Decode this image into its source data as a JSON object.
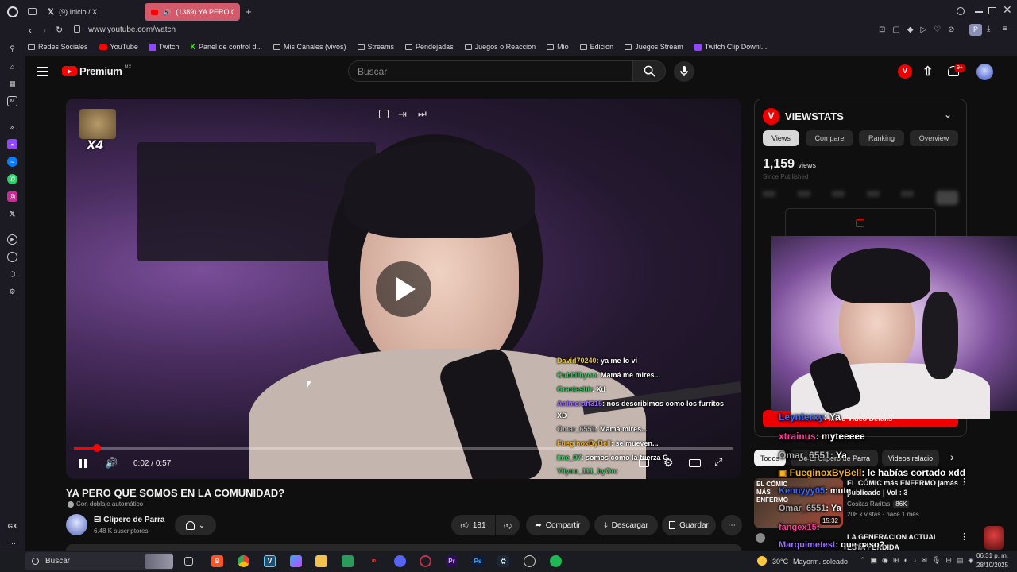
{
  "browser": {
    "tabs": [
      {
        "label": "(9) Inicio / X"
      },
      {
        "label": "(1389) YA PERO QUE"
      }
    ],
    "new_tab": "+",
    "url": "www.youtube.com/watch",
    "bookmarks": [
      {
        "label": "Redes Sociales"
      },
      {
        "label": "YouTube"
      },
      {
        "label": "Twitch"
      },
      {
        "label": "Panel de control d..."
      },
      {
        "label": "Mis Canales (vivos)"
      },
      {
        "label": "Streams"
      },
      {
        "label": "Pendejadas"
      },
      {
        "label": "Juegos o Reaccion"
      },
      {
        "label": "Mio"
      },
      {
        "label": "Edicion"
      },
      {
        "label": "Juegos Stream"
      },
      {
        "label": "Twitch Clip Downl..."
      }
    ],
    "sidebar_bottom": "GX",
    "profile_initial": "P"
  },
  "youtube": {
    "logo": "Premium",
    "region": "MX",
    "search_placeholder": "Buscar",
    "notif_count": "9+",
    "vs_badge": "V"
  },
  "video": {
    "overlay_multiplier": "X4",
    "time_current": "0:02",
    "time_total": "0:57",
    "progress": 0.035,
    "title": "YA PERO QUE SOMOS EN LA COMUNIDAD?",
    "dub_label": "Con doblaje automático",
    "channel": "El Clipero de Parra",
    "subscribers": "6.48 K suscriptores",
    "likes": "181",
    "share": "Compartir",
    "download": "Descargar",
    "save": "Guardar",
    "chat": [
      {
        "user": "David70240",
        "msg": ": ya me lo vi",
        "color": "#e6c84a"
      },
      {
        "user": "Cubit0byon",
        "msg": ": Mamá    me mires...",
        "color": "#46c46a"
      },
      {
        "user": "Graciasbb",
        "msg": ": Xd",
        "color": "#46c46a"
      },
      {
        "user": "Animcraft315",
        "msg": ": nos describimos como los furritos",
        "color": "#9a6cff"
      },
      {
        "user": "",
        "msg": "XD",
        "color": "#ffffff"
      },
      {
        "user": "Omar_6551",
        "msg": ": Mamá    mires...",
        "color": "#b0b0b0"
      },
      {
        "user": "FueginoxByBell",
        "msg": ": se mueven...",
        "color": "#f0b32a"
      },
      {
        "user": "ime_07",
        "msg": ": somos como la fuerza G",
        "color": "#46c46a"
      },
      {
        "user": "Yiiyoo_111_byOn",
        "msg": ":",
        "color": "#46c46a"
      }
    ]
  },
  "viewstats": {
    "title": "VIEWSTATS",
    "tabs": [
      "Views",
      "Compare",
      "Ranking",
      "Overview"
    ],
    "count": "1,159",
    "count_unit": "views",
    "since": "Since Published",
    "more_details": "More Video Details"
  },
  "stream_overlay_chat": [
    {
      "user": "Leynterxy",
      "msg": ": Ya",
      "color": "#3a66ff"
    },
    {
      "user": "xtrainus",
      "msg": ": myteeeee",
      "color": "#ff3b9a"
    },
    {
      "user": "Omar_6551",
      "msg": ": Ya",
      "color": "#b0b0b0"
    },
    {
      "user": "FueginoxByBell",
      "msg": ": le habías cortado xdd",
      "color": "#f0b32a"
    },
    {
      "user": "Kennyyy05",
      "msg": ": mute",
      "color": "#3a66ff"
    },
    {
      "user": "Omar_6551",
      "msg": ": Ya",
      "color": "#b0b0b0"
    },
    {
      "user": "fangex15",
      "msg": ":",
      "color": "#ff3b9a"
    },
    {
      "user": "Marquimetest",
      "msg": ": que paso?",
      "color": "#9a6cff"
    }
  ],
  "related": {
    "chips": [
      "Todos",
      "De El Clipero de Parra",
      "Videos relacio"
    ],
    "items": [
      {
        "title": "EL CÓMIC más ENFERMO jamás publicado | Vol : 3",
        "channel": "Cositas Raritas",
        "badge": "86K",
        "meta": "208 k vistas · hace 1 mes",
        "duration": "15:32",
        "thumb_text": "EL CÓMIC MÁS ENFERMO"
      },
      {
        "title": "LA GENERACION ACTUAL ESTA PERDIDA",
        "channel": "",
        "badge": "",
        "meta": "",
        "duration": "",
        "thumb_text": ""
      }
    ]
  },
  "taskbar": {
    "search": "Buscar",
    "temp": "30°C",
    "weather": "Mayorm. soleado",
    "time": "06:31 p. m.",
    "date": "28/10/2025"
  },
  "colors": {
    "yt_red": "#ff0000",
    "accent_blue": "#3ea6ff",
    "chrome": "#1c1a22"
  }
}
